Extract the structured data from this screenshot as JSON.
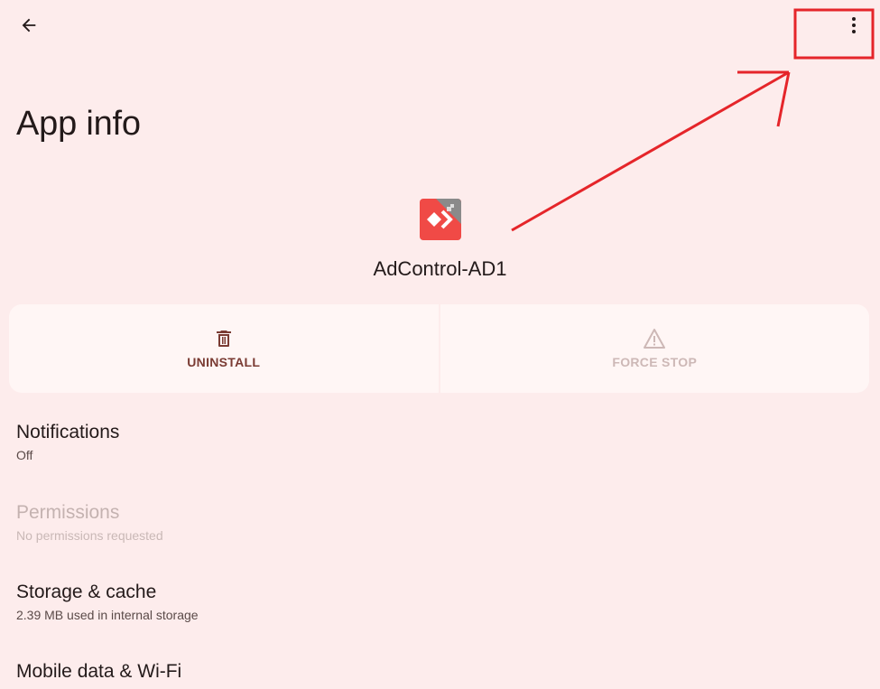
{
  "toolbar": {
    "back_icon": "arrow-left-icon",
    "overflow_icon": "more-vert-icon"
  },
  "page": {
    "title": "App info"
  },
  "app": {
    "name": "AdControl-AD1",
    "icon_colors": [
      "#F04A46",
      "#8A8A8A"
    ]
  },
  "actions": {
    "uninstall": {
      "label": "UNINSTALL",
      "icon": "trash-icon"
    },
    "force_stop": {
      "label": "FORCE STOP",
      "icon": "warning-icon"
    }
  },
  "settings": {
    "notifications": {
      "title": "Notifications",
      "summary": "Off"
    },
    "permissions": {
      "title": "Permissions",
      "summary": "No permissions requested"
    },
    "storage": {
      "title": "Storage & cache",
      "summary": "2.39 MB used in internal storage"
    },
    "mobile_data": {
      "title": "Mobile data & Wi-Fi"
    }
  },
  "colors": {
    "background": "#FDECEC",
    "button_bg": "#FFF6F5",
    "uninstall_accent": "#7A3B33",
    "disabled_text": "#CDB8B6",
    "annotation_red": "#E5252A"
  }
}
